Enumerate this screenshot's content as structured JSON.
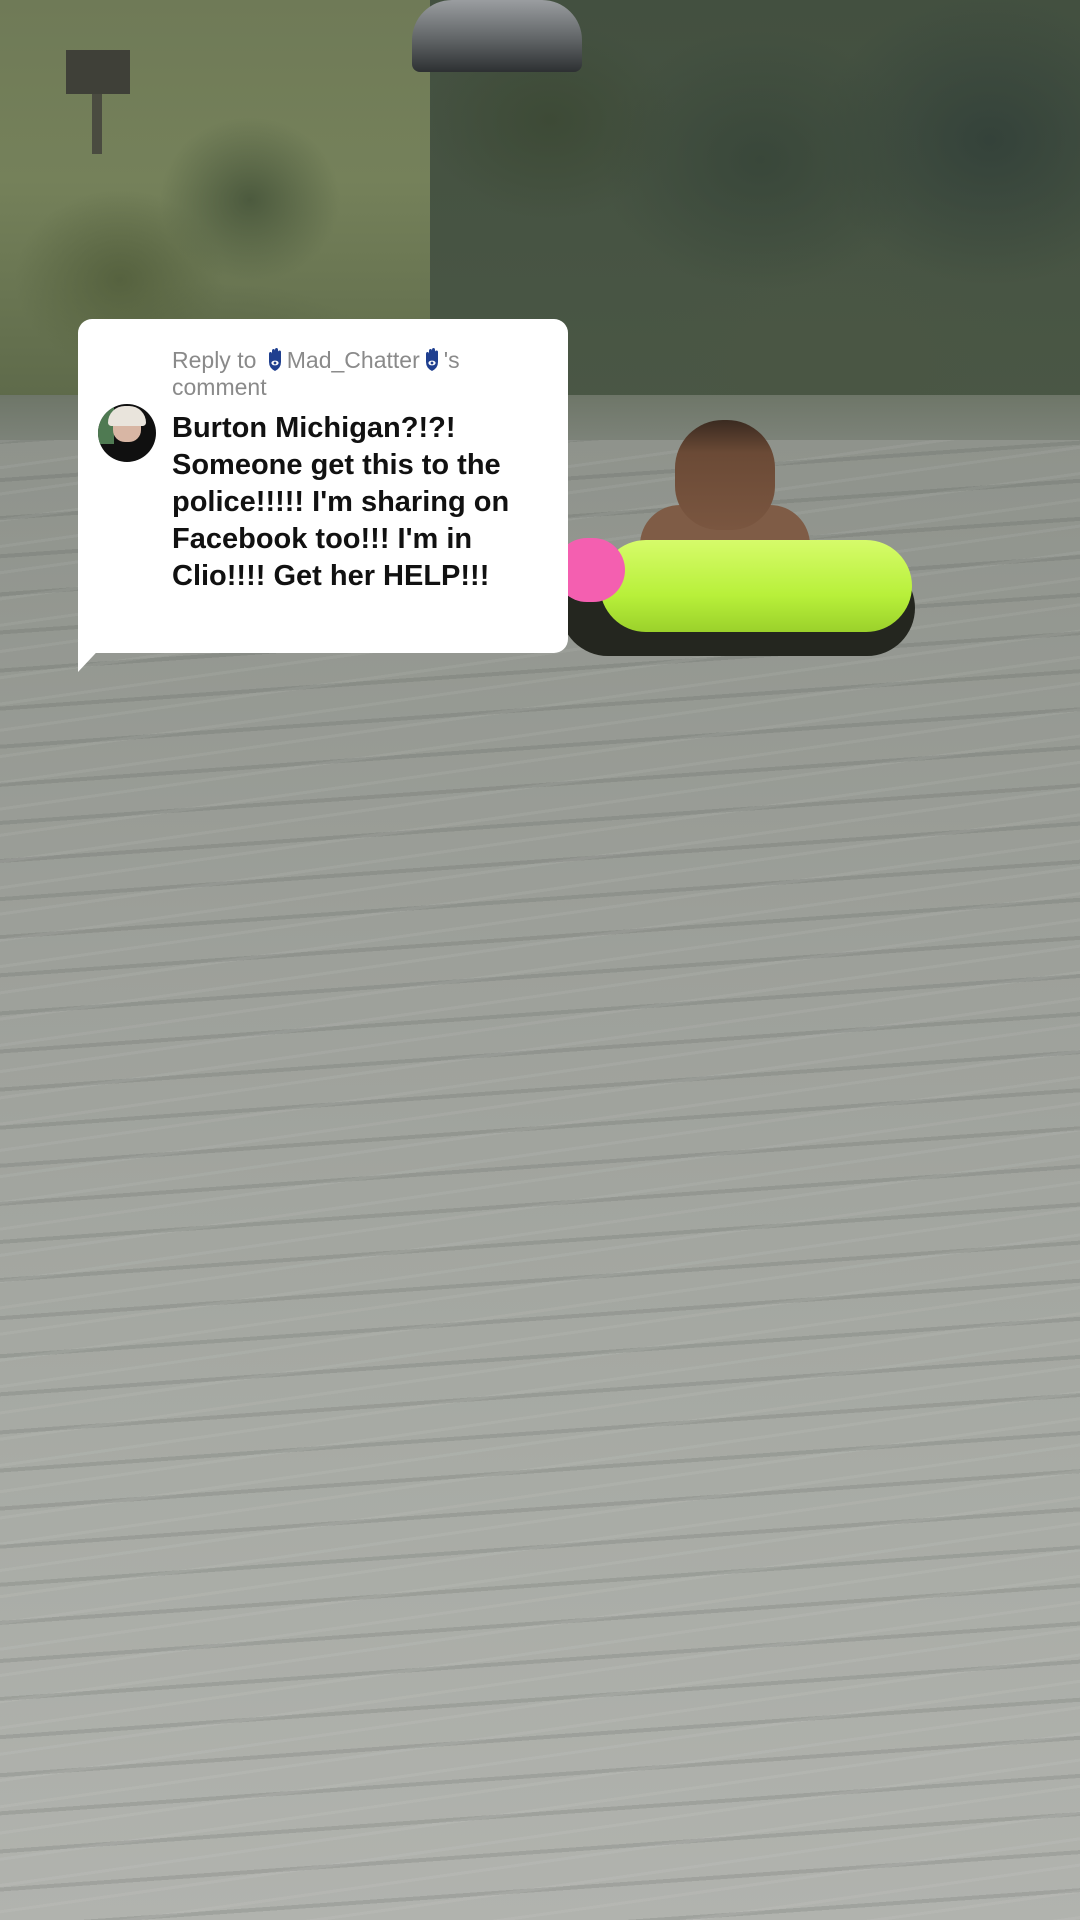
{
  "reply": {
    "prefix": "Reply to",
    "username": "Mad_Chatter",
    "suffix": "'s",
    "second_line": "comment",
    "comment_text": "Burton Michigan?!?! Someone get this to the police!!!!! I'm sharing on Facebook too!!! I'm in Clio!!!! Get her HELP!!!",
    "username_icon": "hamsa-icon"
  },
  "colors": {
    "card_bg": "#ffffff",
    "header_text": "#8a8a8a",
    "comment_text": "#111111",
    "icon_blue": "#1f3f8f"
  }
}
